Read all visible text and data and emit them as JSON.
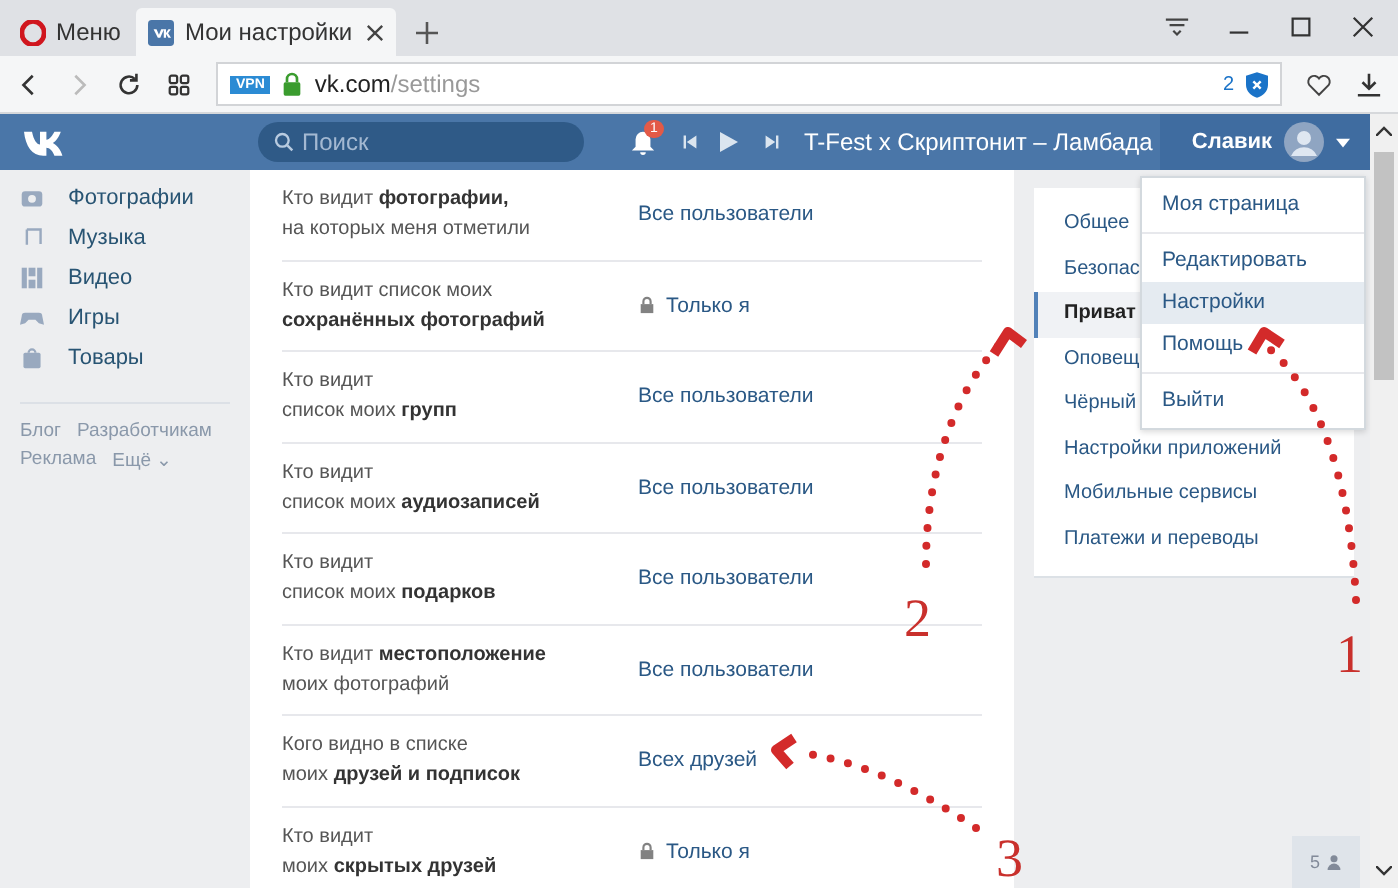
{
  "browser": {
    "tabs": [
      {
        "kind": "menu",
        "label": "Меню",
        "selected": false
      },
      {
        "kind": "page",
        "label": "Мои настройки",
        "selected": true
      }
    ],
    "address": {
      "vpn": "VPN",
      "host": "vk.com",
      "path": "/settings",
      "blocked": "2"
    }
  },
  "header": {
    "search_placeholder": "Поиск",
    "notifications": "1",
    "track": "T-Fest x Скриптонит – Ламбада",
    "user": "Славик"
  },
  "sidebar": {
    "items": [
      {
        "kind": "photos",
        "label": "Фотографии"
      },
      {
        "kind": "music",
        "label": "Музыка"
      },
      {
        "kind": "video",
        "label": "Видео"
      },
      {
        "kind": "games",
        "label": "Игры"
      },
      {
        "kind": "goods",
        "label": "Товары"
      }
    ],
    "links": [
      "Блог",
      "Разработчикам",
      "Реклама",
      "Ещё ⌄"
    ]
  },
  "settings": [
    {
      "label": "Кто видит **фотографии,**",
      "label2": "на которых меня отметили",
      "value": "Все пользователи",
      "locked": false
    },
    {
      "label": "Кто видит список моих",
      "label2": "**сохранённых фотографий**",
      "value": "Только я",
      "locked": true
    },
    {
      "label": "Кто видит",
      "label2": "список моих **групп**",
      "value": "Все пользователи",
      "locked": false
    },
    {
      "label": "Кто видит",
      "label2": "список моих **аудиозаписей**",
      "value": "Все пользователи",
      "locked": false
    },
    {
      "label": "Кто видит",
      "label2": "список моих **подарков**",
      "value": "Все пользователи",
      "locked": false
    },
    {
      "label": "Кто видит **местоположение**",
      "label2": "моих фотографий",
      "value": "Все пользователи",
      "locked": false
    },
    {
      "label": "Кого видно в списке",
      "label2": "моих **друзей и подписок**",
      "value": "Всех друзей",
      "locked": false
    },
    {
      "label": "Кто видит",
      "label2": "моих **скрытых друзей**",
      "value": "Только я",
      "locked": true
    }
  ],
  "settings_menu": [
    {
      "label": "Общее",
      "selected": false
    },
    {
      "label": "Безопас",
      "selected": false
    },
    {
      "label": "Приват",
      "selected": true
    },
    {
      "label": "Оповещ",
      "selected": false
    },
    {
      "label": "Чёрный",
      "selected": false
    },
    {
      "label": "Настройки приложений",
      "selected": false
    },
    {
      "label": "Мобильные сервисы",
      "selected": false
    },
    {
      "label": "Платежи и переводы",
      "selected": false
    }
  ],
  "user_menu": [
    {
      "label": "Моя страница",
      "selected": false,
      "divider_after": true
    },
    {
      "label": "Редактировать",
      "selected": false,
      "divider_after": false
    },
    {
      "label": "Настройки",
      "selected": true,
      "divider_after": false
    },
    {
      "label": "Помощь",
      "selected": false,
      "divider_after": true
    },
    {
      "label": "Выйти",
      "selected": false,
      "divider_after": false
    }
  ],
  "online_friends": "5",
  "annotations": [
    "1",
    "2",
    "3"
  ]
}
